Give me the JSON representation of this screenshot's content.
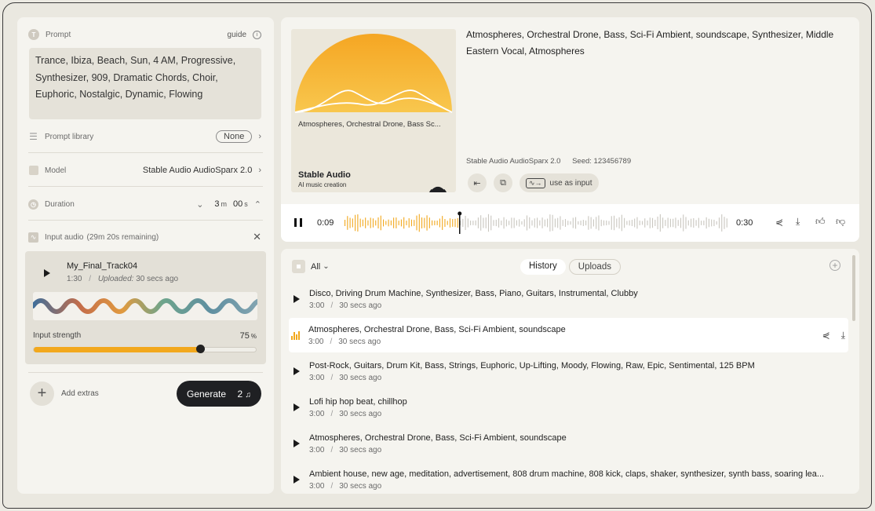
{
  "left": {
    "prompt": {
      "label": "Prompt",
      "guide": "guide",
      "text": "Trance, Ibiza, Beach, Sun, 4 AM, Progressive, Synthesizer, 909, Dramatic Chords, Choir, Euphoric, Nostalgic, Dynamic, Flowing"
    },
    "library": {
      "label": "Prompt library",
      "value": "None"
    },
    "model": {
      "label": "Model",
      "value": "Stable Audio AudioSparx 2.0"
    },
    "duration": {
      "label": "Duration",
      "minutes": "3",
      "m_unit": "m",
      "seconds": "00",
      "s_unit": "s"
    },
    "input_audio": {
      "label": "Input audio",
      "remaining": "(29m 20s remaining)",
      "track_name": "My_Final_Track04",
      "track_length": "1:30",
      "uploaded_label": "Uploaded:",
      "uploaded_value": "30 secs ago",
      "strength_label": "Input strength",
      "strength_value": "75",
      "strength_unit": "%",
      "strength_fraction": 0.75
    },
    "add_extras": "Add extras",
    "generate": {
      "label": "Generate",
      "count": "2"
    }
  },
  "track": {
    "cover_text": "Atmospheres, Orchestral Drone, Bass Sc...",
    "brand": "Stable Audio",
    "brand_sub": "AI music creation",
    "title": "Atmospheres, Orchestral Drone, Bass, Sci-Fi Ambient, soundscape, Synthesizer, Middle Eastern Vocal, Atmospheres",
    "model": "Stable Audio AudioSparx 2.0",
    "seed_label": "Seed:",
    "seed_value": "123456789",
    "use_as_input": "use as input"
  },
  "player": {
    "current": "0:09",
    "total": "0:30",
    "progress_fraction": 0.3
  },
  "history": {
    "filter": "All",
    "tabs": [
      "History",
      "Uploads"
    ],
    "items": [
      {
        "title": "Disco, Driving Drum Machine, Synthesizer, Bass, Piano, Guitars, Instrumental, Clubby",
        "length": "3:00",
        "time": "30 secs ago"
      },
      {
        "title": "Atmospheres, Orchestral Drone, Bass, Sci-Fi Ambient, soundscape",
        "length": "3:00",
        "time": "30 secs ago"
      },
      {
        "title": "Post-Rock, Guitars, Drum Kit, Bass, Strings, Euphoric, Up-Lifting, Moody, Flowing, Raw, Epic, Sentimental, 125 BPM",
        "length": "3:00",
        "time": "30 secs ago"
      },
      {
        "title": "Lofi hip hop beat, chillhop",
        "length": "3:00",
        "time": "30 secs ago"
      },
      {
        "title": "Atmospheres, Orchestral Drone, Bass, Sci-Fi Ambient, soundscape",
        "length": "3:00",
        "time": "30 secs ago"
      },
      {
        "title": "Ambient house, new age, meditation, advertisement, 808 drum machine, 808 kick, claps, shaker, synthesizer, synth bass, soaring lea...",
        "length": "3:00",
        "time": "30 secs ago"
      }
    ]
  },
  "colors": {
    "accent": "#f2a81d",
    "dark": "#1f2023",
    "panel": "#f5f4ef"
  }
}
